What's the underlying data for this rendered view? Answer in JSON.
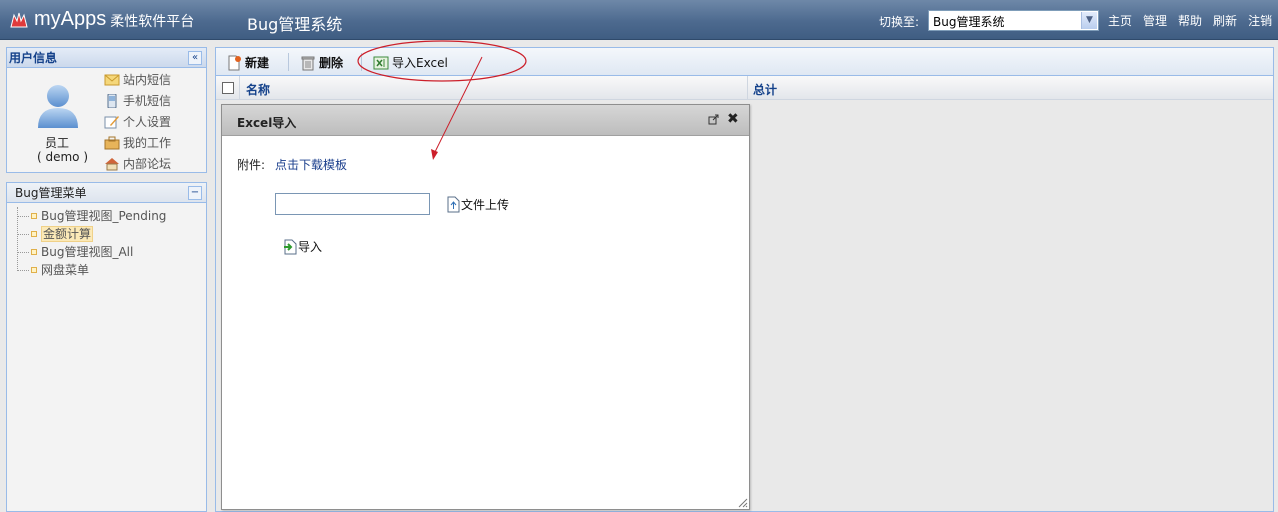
{
  "header": {
    "logo_text": "myApps",
    "logo_sub": "柔性软件平台",
    "system_title": "Bug管理系统",
    "switch_label": "切换至:",
    "switch_value": "Bug管理系统",
    "links": [
      "主页",
      "管理",
      "帮助",
      "刷新",
      "注销"
    ]
  },
  "user_panel": {
    "title": "用户信息",
    "collapse_icon": "«",
    "role": "员工",
    "username": "( demo )",
    "links": [
      "站内短信",
      "手机短信",
      "个人设置",
      "我的工作",
      "内部论坛"
    ]
  },
  "menu_panel": {
    "title": "Bug管理菜单",
    "collapse_icon": "−",
    "items": [
      "Bug管理视图_Pending",
      "金额计算",
      "Bug管理视图_All",
      "网盘菜单"
    ],
    "selected_index": 1
  },
  "toolbar": {
    "new_label": "新建",
    "delete_label": "删除",
    "import_label": "导入Excel"
  },
  "grid": {
    "columns": [
      "名称",
      "总计"
    ]
  },
  "dialog": {
    "title": "Excel导入",
    "attach_label": "附件:",
    "download_link": "点击下载模板",
    "file_value": "",
    "upload_label": "文件上传",
    "import_label": "导入"
  },
  "colors": {
    "header": "#4d6a8f",
    "panel_border": "#99bbe8",
    "panel_title": "#15428b",
    "annotation": "#cc1f2a"
  }
}
